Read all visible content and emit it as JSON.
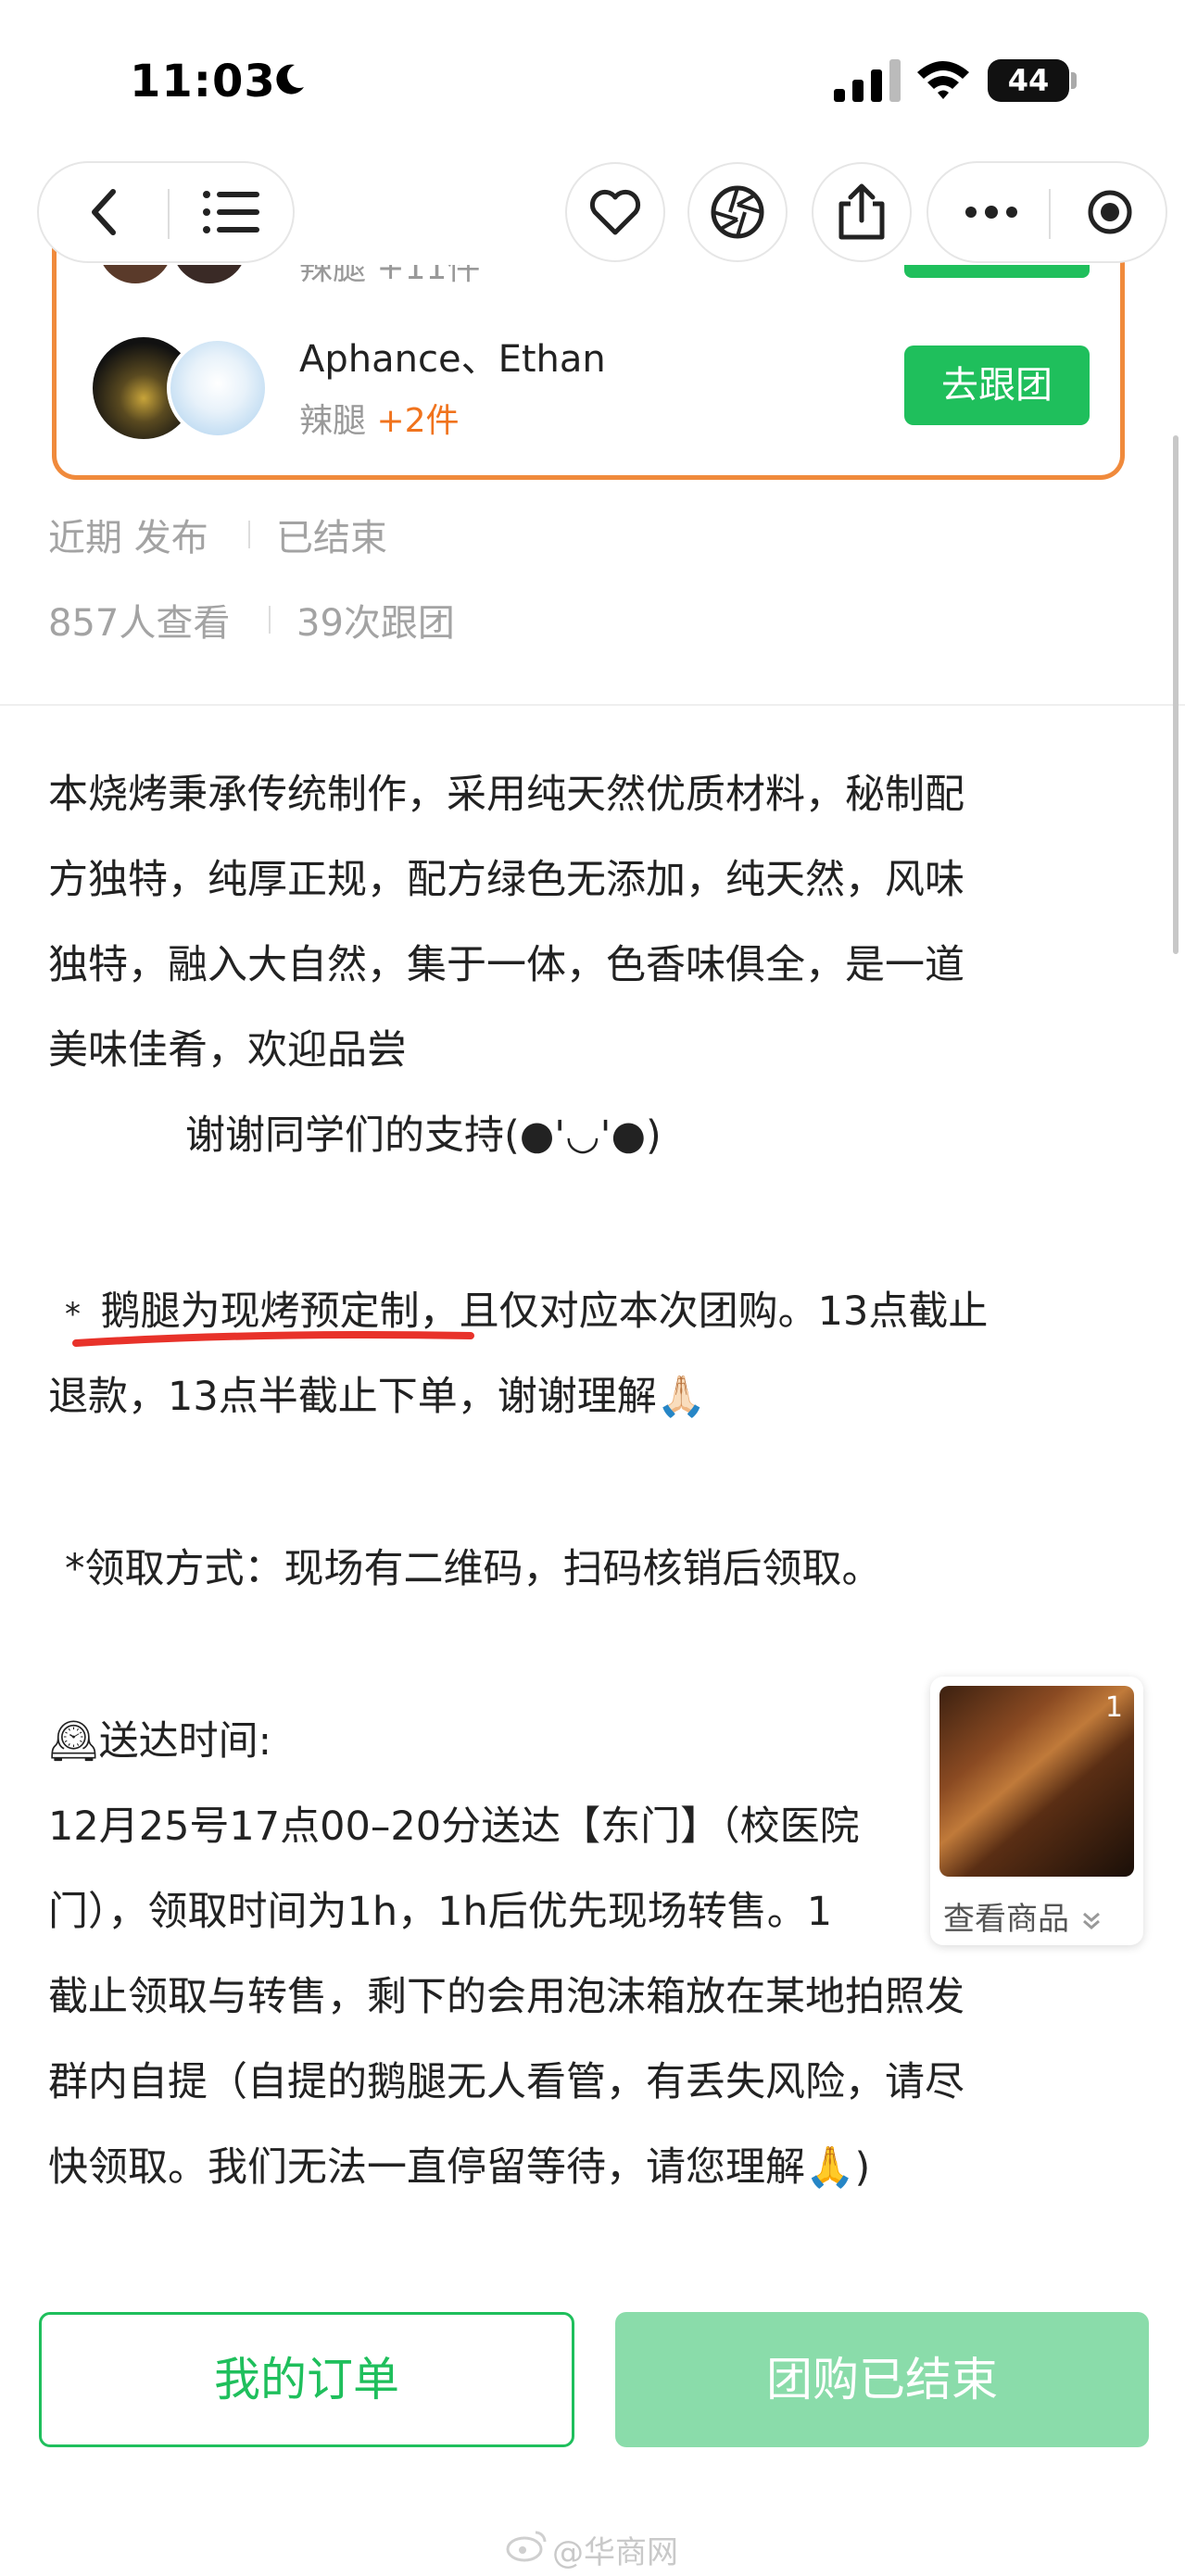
{
  "status_bar": {
    "time": "11:03",
    "battery": "44"
  },
  "nav": {
    "back_icon": "chevron-left-icon",
    "menu_icon": "list-icon",
    "favorite_icon": "heart-icon",
    "camera_icon": "aperture-icon",
    "share_icon": "share-icon",
    "more_icon": "more-dots-icon",
    "close_icon": "record-icon"
  },
  "group_card": {
    "partial_row_sub": "辣腿 +11件",
    "buyer_names": "Aphance、Ethan",
    "buyer_item": "辣腿",
    "buyer_count": "+2件",
    "join_label": "去跟团",
    "border_color": "#f08a3c",
    "accent_color": "#1fbf5c"
  },
  "meta": {
    "published": "近期 发布",
    "status": "已结束",
    "views": "857人查看",
    "joins": "39次跟团"
  },
  "description": {
    "para1": [
      "本烧烤秉承传统制作，采用纯天然优质材料，秘制配",
      "方独特，纯厚正规，配方绿色无添加，纯天然，风味",
      "独特，融入大自然，集于一体，色香味俱全，是一道",
      "美味佳肴，欢迎品尝"
    ],
    "thanks": "谢谢同学们的支持(●'◡'●)",
    "note1_line1_star": "*",
    "note1_line1_highlight": "鹅腿为现烤预定制",
    "note1_line1_rest": "，且仅对应本次团购。13点截止",
    "note1_line2": "退款，13点半截止下单，谢谢理解🙏🏻",
    "note2": "*领取方式：现场有二维码，扫码核销后领取。",
    "delivery_title": "🕰送达时间:",
    "delivery_lines": [
      "12月25号17点00–20分送达【东门】（校医院",
      "门），领取时间为1h，1h后优先现场转售。1",
      "截止领取与转售，剩下的会用泡沫箱放在某地拍照发",
      "群内自提（自提的鹅腿无人看管，有丢失风险，请尽",
      "快领取。我们无法一直停留等待，请您理解🙏)"
    ]
  },
  "product_float": {
    "count": "1",
    "label": "查看商品"
  },
  "footer": {
    "orders_label": "我的订单",
    "ended_label": "团购已结束"
  },
  "watermark": "@华商网"
}
